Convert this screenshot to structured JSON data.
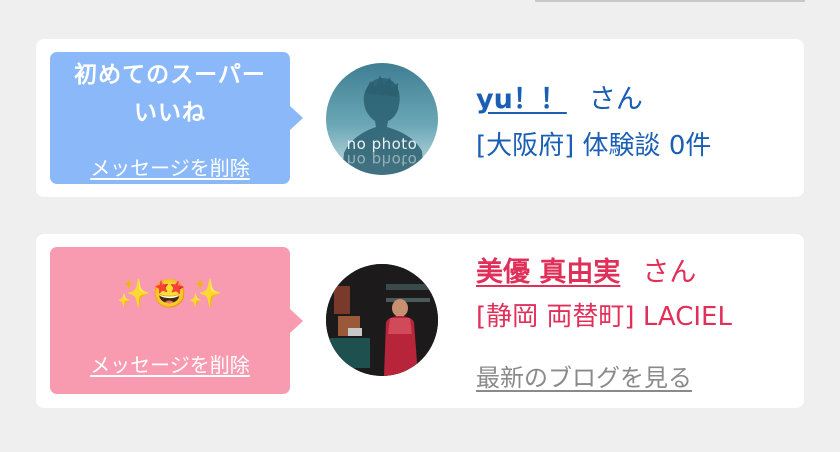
{
  "cards": [
    {
      "message": "初めてのスーパー\nいいね",
      "delete_label": "メッセージを削除",
      "avatar_text": "no photo",
      "name": "yu！！",
      "honorific": "さん",
      "subtitle": "[大阪府] 体験談 0件",
      "bubble_color": "#8ab8f8",
      "text_color": "#1a5fb4"
    },
    {
      "message": "✨🤩✨",
      "delete_label": "メッセージを削除",
      "name": "美優 真由実",
      "honorific": "さん",
      "subtitle": "[静岡 両替町] LACIEL",
      "blog_label": "最新のブログを見る",
      "bubble_color": "#f89ab0",
      "text_color": "#e0305a"
    }
  ]
}
